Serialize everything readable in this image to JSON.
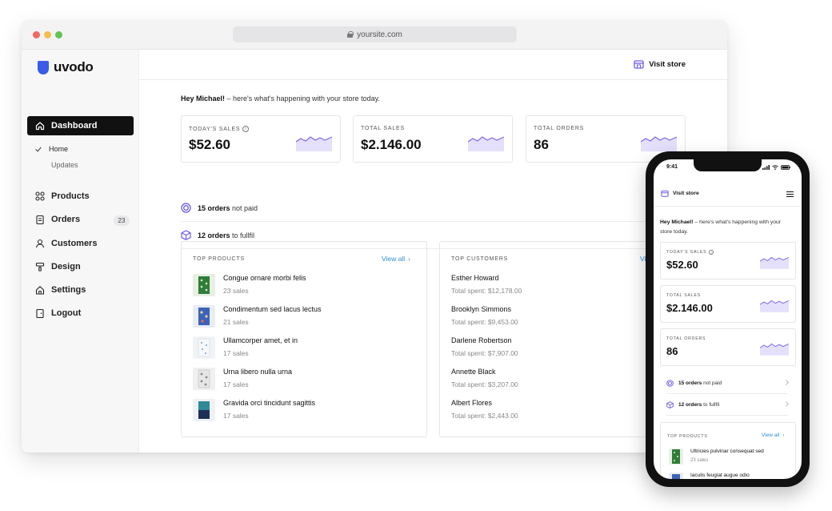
{
  "browser": {
    "url": "yoursite.com"
  },
  "brand": {
    "name": "uvodo",
    "accent": "#3a5ce8"
  },
  "sidebar": {
    "active": "Dashboard",
    "sub_items": [
      "Home",
      "Updates"
    ],
    "items": [
      {
        "label": "Products",
        "icon": "grid-icon"
      },
      {
        "label": "Orders",
        "icon": "clipboard-icon",
        "badge": "23"
      },
      {
        "label": "Customers",
        "icon": "user-icon"
      },
      {
        "label": "Design",
        "icon": "paint-roller-icon"
      },
      {
        "label": "Settings",
        "icon": "home-settings-icon"
      },
      {
        "label": "Logout",
        "icon": "logout-icon"
      }
    ]
  },
  "header": {
    "visit_store": "Visit store"
  },
  "greeting": {
    "name": "Hey Michael!",
    "rest": " – here's what's happening with your store today."
  },
  "stats": [
    {
      "label": "TODAY'S SALES",
      "value": "$52.60",
      "has_info": true
    },
    {
      "label": "TOTAL SALES",
      "value": "$2.146.00"
    },
    {
      "label": "TOTAL ORDERS",
      "value": "86"
    }
  ],
  "alerts": [
    {
      "bold": "15 orders",
      "text": " not paid",
      "icon": "target-icon"
    },
    {
      "bold": "12 orders",
      "text": " to fullfil",
      "icon": "box-icon"
    }
  ],
  "top_products": {
    "title": "TOP PRODUCTS",
    "view_all": "View all",
    "items": [
      {
        "name": "Congue ornare morbi felis",
        "sales": "23 sales"
      },
      {
        "name": "Condimentum sed lacus lectus",
        "sales": "21 sales"
      },
      {
        "name": "Ullamcorper amet, et in",
        "sales": "17 sales"
      },
      {
        "name": "Urna libero nulla urna",
        "sales": "17 sales"
      },
      {
        "name": "Gravida orci tincidunt sagittis",
        "sales": "17 sales"
      }
    ]
  },
  "top_customers": {
    "title": "TOP CUSTOMERS",
    "view_all": "Vi",
    "items": [
      {
        "name": "Esther Howard",
        "spent": "Total spent: $12,178.00"
      },
      {
        "name": "Brooklyn Simmons",
        "spent": "Total spent: $9,453.00"
      },
      {
        "name": "Darlene Robertson",
        "spent": "Total spent: $7,907.00"
      },
      {
        "name": "Annette Black",
        "spent": "Total spent: $3,207.00"
      },
      {
        "name": "Albert Flores",
        "spent": "Total spent: $2,443.00"
      }
    ]
  },
  "mobile": {
    "time": "9:41",
    "visit_store": "Visit store",
    "greeting_name": "Hey Michael!",
    "greeting_rest": " – here's what's happening with your store today.",
    "products": [
      {
        "name": "Ultricies pulvinar consequat sed",
        "sales": "23 sales"
      },
      {
        "name": "Iaculis feugiat augue odio",
        "sales": ""
      }
    ]
  }
}
